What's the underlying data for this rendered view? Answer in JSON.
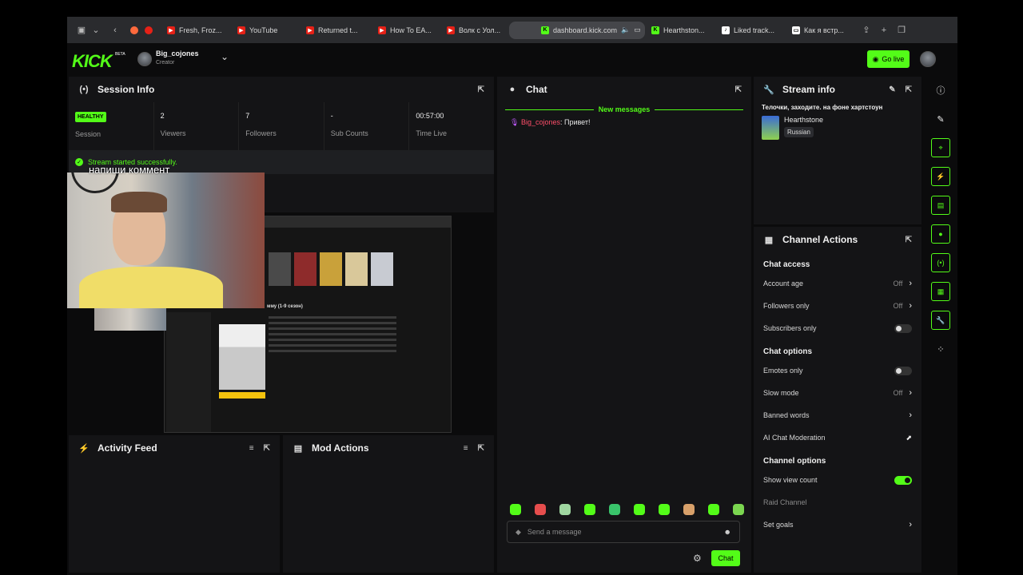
{
  "browser": {
    "tabs": [
      {
        "label": "Fresh, Froz..."
      },
      {
        "label": "YouTube"
      },
      {
        "label": "Returned t..."
      },
      {
        "label": "How To EA..."
      },
      {
        "label": "Волк с Уол..."
      },
      {
        "label": "dashboard.kick.com",
        "active": true
      },
      {
        "label": "Hearthston..."
      },
      {
        "label": "Liked track..."
      },
      {
        "label": "Как я встр..."
      }
    ]
  },
  "header": {
    "logo": "KICK",
    "logo_badge": "BETA",
    "user_name": "Big_cojones",
    "user_role": "Creator",
    "go_live": "Go live"
  },
  "session": {
    "title": "Session Info",
    "health": "HEALTHY",
    "health_label": "Session",
    "viewers": "2",
    "viewers_label": "Viewers",
    "followers": "7",
    "followers_label": "Followers",
    "subs": "-",
    "subs_label": "Sub Counts",
    "time_live": "00:57:00",
    "time_label": "Time Live",
    "toast": "Stream started successfully.",
    "overlay_text": "напиши коммент"
  },
  "chat": {
    "title": "Chat",
    "new_messages": "New messages",
    "messages": [
      {
        "user": "Big_cojones",
        "text": ": Привет!"
      }
    ],
    "input_placeholder": "Send a message",
    "send": "Chat"
  },
  "activity": {
    "title": "Activity Feed"
  },
  "mod_actions": {
    "title": "Mod Actions"
  },
  "stream_info": {
    "title": "Stream info",
    "stream_title": "Телочки, заходите. на фоне хартстоун",
    "category": "Hearthstone",
    "language": "Russian"
  },
  "channel_actions": {
    "title": "Channel Actions",
    "chat_access": "Chat access",
    "account_age": "Account age",
    "account_age_val": "Off",
    "followers_only": "Followers only",
    "followers_only_val": "Off",
    "subscribers_only": "Subscribers only",
    "chat_options": "Chat options",
    "emotes_only": "Emotes only",
    "slow_mode": "Slow mode",
    "slow_mode_val": "Off",
    "banned_words": "Banned words",
    "ai_moderation": "AI Chat Moderation",
    "channel_options": "Channel options",
    "show_view_count": "Show view count",
    "raid_channel": "Raid Channel",
    "set_goals": "Set goals"
  },
  "colors": {
    "accent": "#53fc18",
    "panel": "#141416",
    "chat_user": "#ff4e6a"
  }
}
